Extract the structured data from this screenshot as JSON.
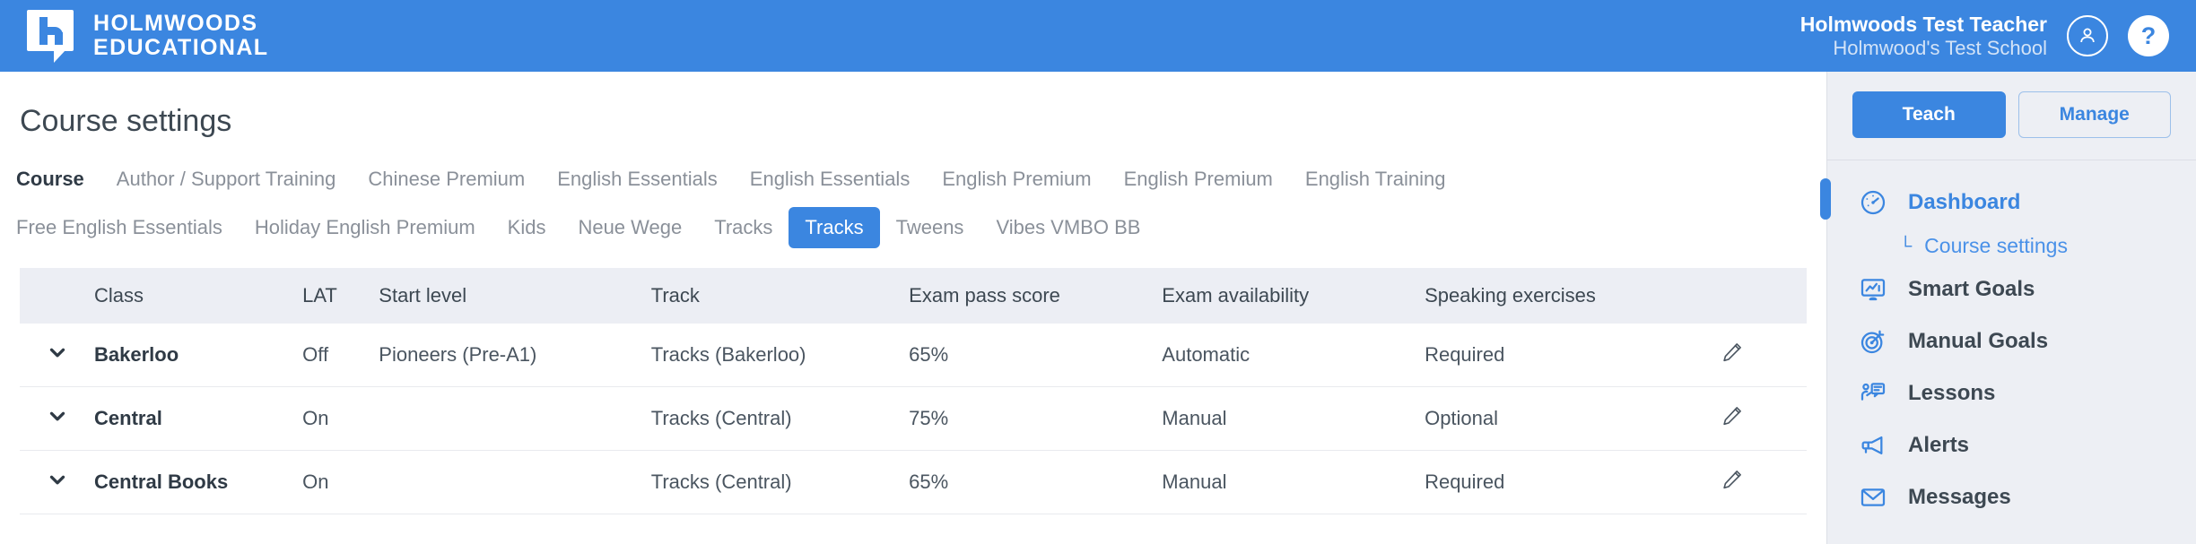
{
  "header": {
    "brand_line1": "HOLMWOODS",
    "brand_line2": "EDUCATIONAL",
    "user_name": "Holmwoods Test Teacher",
    "user_school": "Holmwood's Test School",
    "help_glyph": "?",
    "accent_blue": "#3b86e0",
    "avatar_icon": "user-avatar-icon",
    "help_icon": "help-question-icon"
  },
  "main": {
    "page_title": "Course settings",
    "tabs_row1": [
      {
        "label": "Course",
        "state": "active-plain"
      },
      {
        "label": "Author / Support Training",
        "state": ""
      },
      {
        "label": "Chinese Premium",
        "state": ""
      },
      {
        "label": "English Essentials",
        "state": ""
      },
      {
        "label": "English Essentials",
        "state": ""
      },
      {
        "label": "English Premium",
        "state": ""
      },
      {
        "label": "English Premium",
        "state": ""
      },
      {
        "label": "English Training",
        "state": ""
      }
    ],
    "tabs_row2": [
      {
        "label": "Free English Essentials",
        "state": ""
      },
      {
        "label": "Holiday English Premium",
        "state": ""
      },
      {
        "label": "Kids",
        "state": ""
      },
      {
        "label": "Neue Wege",
        "state": ""
      },
      {
        "label": "Tracks",
        "state": ""
      },
      {
        "label": "Tracks",
        "state": "active-pill"
      },
      {
        "label": "Tweens",
        "state": ""
      },
      {
        "label": "Vibes VMBO BB",
        "state": ""
      }
    ],
    "table": {
      "columns": [
        "",
        "Class",
        "LAT",
        "Start level",
        "Track",
        "Exam pass score",
        "Exam availability",
        "Speaking exercises",
        ""
      ],
      "rows": [
        {
          "caret": "⌄",
          "class": "Bakerloo",
          "lat": "Off",
          "start_level": "Pioneers (Pre-A1)",
          "track": "Tracks (Bakerloo)",
          "exam_pass_score": "65%",
          "exam_availability": "Automatic",
          "speaking_exercises": "Required",
          "edit_icon": "pencil-edit-icon"
        },
        {
          "caret": "⌄",
          "class": "Central",
          "lat": "On",
          "start_level": "",
          "track": "Tracks (Central)",
          "exam_pass_score": "75%",
          "exam_availability": "Manual",
          "speaking_exercises": "Optional",
          "edit_icon": "pencil-edit-icon"
        },
        {
          "caret": "⌄",
          "class": "Central Books",
          "lat": "On",
          "start_level": "",
          "track": "Tracks (Central)",
          "exam_pass_score": "65%",
          "exam_availability": "Manual",
          "speaking_exercises": "Required",
          "edit_icon": "pencil-edit-icon"
        }
      ]
    }
  },
  "sidebar": {
    "segmented": [
      {
        "label": "Teach",
        "style": "primary"
      },
      {
        "label": "Manage",
        "style": "ghost"
      }
    ],
    "nav": [
      {
        "label": "Dashboard",
        "icon": "dashboard-gauge-icon",
        "active": true
      },
      {
        "label": "Smart Goals",
        "icon": "smart-goals-monitor-icon",
        "active": false
      },
      {
        "label": "Manual Goals",
        "icon": "manual-goals-target-icon",
        "active": false
      },
      {
        "label": "Lessons",
        "icon": "lessons-presenter-icon",
        "active": false
      },
      {
        "label": "Alerts",
        "icon": "alerts-megaphone-icon",
        "active": false
      },
      {
        "label": "Messages",
        "icon": "messages-envelope-icon",
        "active": false
      }
    ],
    "sub_item": {
      "label": "Course settings",
      "elbow": "└"
    }
  }
}
